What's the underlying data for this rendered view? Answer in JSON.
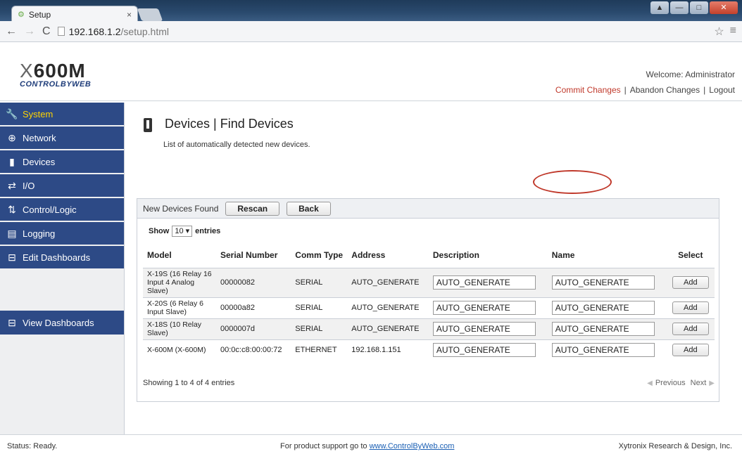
{
  "browser": {
    "tab_title": "Setup",
    "tab_close": "×",
    "url_host": "192.168.1.2",
    "url_path": "/setup.html",
    "window_buttons": [
      "▲",
      "—",
      "□",
      "✕"
    ]
  },
  "header": {
    "logo_text": "600M",
    "logo_prefix": "X",
    "logo_sub": "CONTROLBYWEB",
    "welcome": "Welcome: Administrator",
    "links": [
      "Commit Changes",
      "Abandon Changes",
      "Logout"
    ]
  },
  "sidebar": {
    "items": [
      {
        "label": "System",
        "icon": "wrench-icon",
        "active": true
      },
      {
        "label": "Network",
        "icon": "globe-icon"
      },
      {
        "label": "Devices",
        "icon": "device-icon"
      },
      {
        "label": "I/O",
        "icon": "arrows-icon"
      },
      {
        "label": "Control/Logic",
        "icon": "logic-icon"
      },
      {
        "label": "Logging",
        "icon": "log-icon"
      },
      {
        "label": "Edit Dashboards",
        "icon": "dashboard-icon"
      }
    ],
    "view_dashboards": "View Dashboards"
  },
  "page": {
    "title": "Devices | Find Devices",
    "subtitle": "List of automatically detected new devices."
  },
  "panel": {
    "heading": "New Devices Found",
    "rescan": "Rescan",
    "back": "Back",
    "show_label": "Show",
    "show_value": "10",
    "entries_label": "entries",
    "columns": [
      "Model",
      "Serial Number",
      "Comm Type",
      "Address",
      "Description",
      "Name",
      "Select"
    ],
    "rows": [
      {
        "model": "X-19S (16 Relay 16 Input 4 Analog Slave)",
        "serial": "00000082",
        "comm": "SERIAL",
        "address": "AUTO_GENERATE",
        "description": "AUTO_GENERATE",
        "name": "AUTO_GENERATE",
        "select": "Add"
      },
      {
        "model": "X-20S (6 Relay 6 Input Slave)",
        "serial": "00000a82",
        "comm": "SERIAL",
        "address": "AUTO_GENERATE",
        "description": "AUTO_GENERATE",
        "name": "AUTO_GENERATE",
        "select": "Add"
      },
      {
        "model": "X-18S (10 Relay Slave)",
        "serial": "0000007d",
        "comm": "SERIAL",
        "address": "AUTO_GENERATE",
        "description": "AUTO_GENERATE",
        "name": "AUTO_GENERATE",
        "select": "Add"
      },
      {
        "model": "X-600M (X-600M)",
        "serial": "00:0c:c8:00:00:72",
        "comm": "ETHERNET",
        "address": "192.168.1.151",
        "description": "AUTO_GENERATE",
        "name": "AUTO_GENERATE",
        "select": "Add"
      }
    ],
    "showing": "Showing 1 to 4 of 4 entries",
    "previous": "Previous",
    "next": "Next"
  },
  "footer": {
    "status": "Status:  Ready.",
    "support_prefix": "For product support go to",
    "support_link": "www.ControlByWeb.com",
    "company": "Xytronix Research & Design, Inc."
  },
  "colors": {
    "sidebar_bg": "#2d4a86",
    "active_text": "#ffd400",
    "commit_link": "#c0392b",
    "annotation": "#c0392b"
  }
}
